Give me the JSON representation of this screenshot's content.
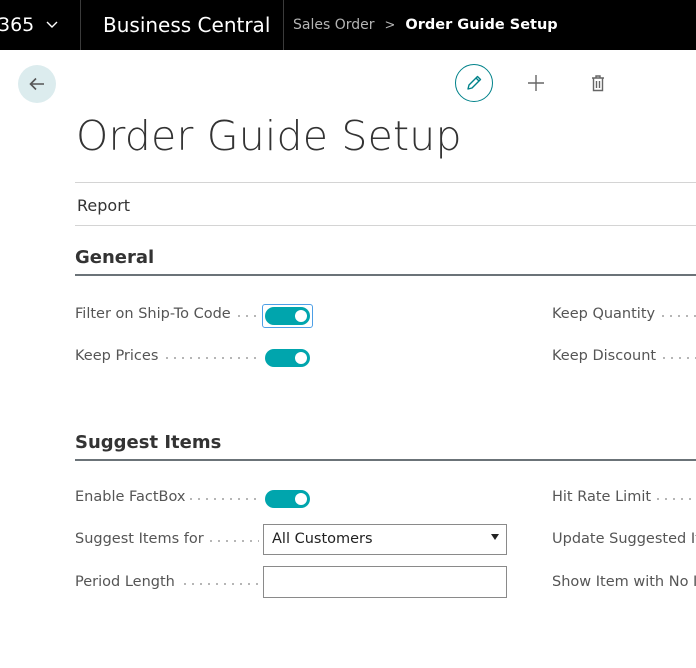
{
  "topbar": {
    "product_fragment": "365",
    "app_name": "Business Central",
    "breadcrumb_parent": "Sales Order",
    "breadcrumb_separator": ">",
    "breadcrumb_current": "Order Guide Setup"
  },
  "page": {
    "title": "Order Guide Setup",
    "menu_report": "Report"
  },
  "icons": {
    "back": "arrow-left-icon",
    "edit": "pencil-icon",
    "add": "plus-icon",
    "delete": "trash-icon"
  },
  "colors": {
    "accent": "#00a5ad",
    "accent_dark": "#00828a",
    "back_bg": "#dcecee",
    "topbar": "#000000"
  },
  "general": {
    "title": "General",
    "filter_ship_to_label": "Filter on Ship-To Code",
    "filter_ship_to_value": true,
    "keep_prices_label": "Keep Prices",
    "keep_prices_value": true,
    "keep_quantity_label": "Keep Quantity",
    "keep_discount_label": "Keep Discount"
  },
  "suggest_items": {
    "title": "Suggest Items",
    "enable_factbox_label": "Enable FactBox",
    "enable_factbox_value": true,
    "suggest_items_for_label": "Suggest Items for",
    "suggest_items_for_value": "All Customers",
    "period_length_label": "Period Length",
    "period_length_value": "",
    "hit_rate_limit_label": "Hit Rate Limit",
    "update_suggested_label": "Update Suggested Ite",
    "show_item_label": "Show Item with No In"
  }
}
